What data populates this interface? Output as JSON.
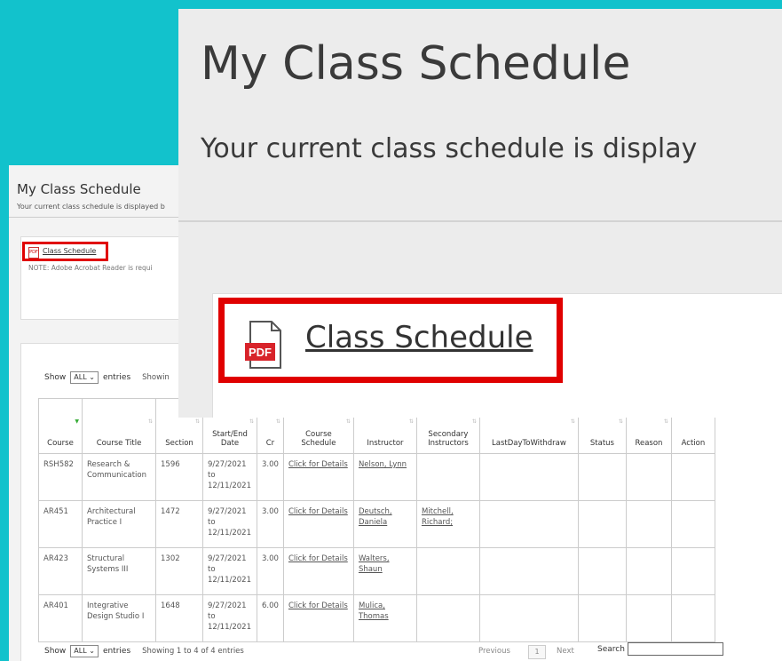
{
  "page": {
    "title": "My Class Schedule",
    "subtitle_small": "Your current class schedule is displayed b",
    "subtitle_zoom": "Your current class schedule is display"
  },
  "schedule_link": {
    "label": "Class Schedule",
    "pdf_text": "PDF",
    "note": "NOTE: Adobe Acrobat Reader is requi"
  },
  "entries": {
    "show_label": "Show",
    "select_value": "ALL",
    "entries_label": "entries",
    "showing_top": "Showin",
    "showing_bottom": "Showing 1 to 4 of 4 entries"
  },
  "table": {
    "headers": [
      "Course",
      "Course Title",
      "Section",
      "Start/End Date",
      "Cr",
      "Course Schedule",
      "Instructor",
      "Secondary Instructors",
      "LastDayToWithdraw",
      "Status",
      "Reason",
      "Action"
    ],
    "rows": [
      {
        "course": "RSH582",
        "title": "Research & Communication",
        "section": "1596",
        "dates": "9/27/2021 to 12/11/2021",
        "cr": "3.00",
        "schedule": "Click for Details",
        "instructor": "Nelson, Lynn",
        "secondary": "",
        "withdraw": "",
        "status": "",
        "reason": "",
        "action": ""
      },
      {
        "course": "AR451",
        "title": "Architectural Practice I",
        "section": "1472",
        "dates": "9/27/2021 to 12/11/2021",
        "cr": "3.00",
        "schedule": "Click for Details",
        "instructor": "Deutsch, Daniela",
        "secondary": "Mitchell, Richard;",
        "withdraw": "",
        "status": "",
        "reason": "",
        "action": ""
      },
      {
        "course": "AR423",
        "title": "Structural Systems III",
        "section": "1302",
        "dates": "9/27/2021 to 12/11/2021",
        "cr": "3.00",
        "schedule": "Click for Details",
        "instructor": "Walters, Shaun",
        "secondary": "",
        "withdraw": "",
        "status": "",
        "reason": "",
        "action": ""
      },
      {
        "course": "AR401",
        "title": "Integrative Design Studio I",
        "section": "1648",
        "dates": "9/27/2021 to 12/11/2021",
        "cr": "6.00",
        "schedule": "Click for Details",
        "instructor": "Mulica, Thomas",
        "secondary": "",
        "withdraw": "",
        "status": "",
        "reason": "",
        "action": ""
      }
    ]
  },
  "pager": {
    "previous": "Previous",
    "page": "1",
    "next": "Next",
    "search_label": "Search"
  },
  "colors": {
    "background": "#12c2cc",
    "highlight": "#e00000"
  }
}
